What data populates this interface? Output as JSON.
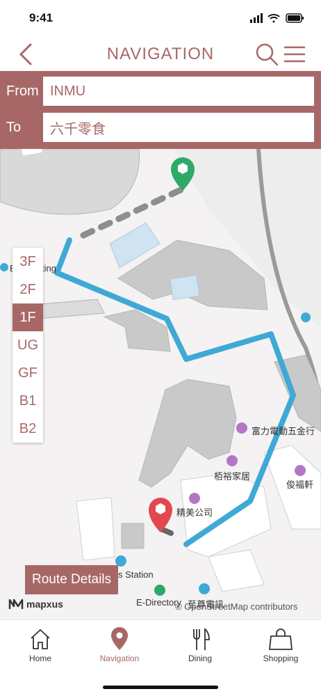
{
  "status_bar": {
    "time": "9:41"
  },
  "header": {
    "title": "NAVIGATION"
  },
  "route": {
    "from_label": "From",
    "from_value": "INMU",
    "to_label": "To",
    "to_value": "六千零食"
  },
  "floors": {
    "items": [
      "3F",
      "2F",
      "1F",
      "UG",
      "GF",
      "B1",
      "B2"
    ],
    "selected": "1F"
  },
  "map": {
    "labels": {
      "bus_stop_top": "Bu",
      "bus_stop_top_suffix": "ting",
      "fuli_store": "富力電動五金行",
      "baiyu": "栢裕家居",
      "junfu": "俊福軒",
      "jingmei": "精美公司",
      "bus_station": "s Station",
      "edirectory": "E-Directory",
      "zhizun": "至尊電訊"
    },
    "attribution": "© OpenStreetMap contributors",
    "logo_text": "mapxus",
    "route_color": "#3fa9d6",
    "origin_marker_color": "#2eaa68",
    "dest_marker_color": "#e2484f"
  },
  "route_details_label": "Route Details",
  "tabs": [
    {
      "label": "Home",
      "icon": "home-icon"
    },
    {
      "label": "Navigation",
      "icon": "location-pin-icon"
    },
    {
      "label": "Dining",
      "icon": "fork-knife-icon"
    },
    {
      "label": "Shopping",
      "icon": "shopping-bag-icon"
    }
  ],
  "active_tab": "Navigation",
  "colors": {
    "accent": "#a86767"
  }
}
